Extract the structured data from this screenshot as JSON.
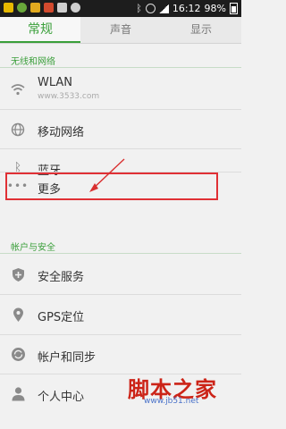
{
  "status_bar": {
    "time": "16:12",
    "battery": "98%",
    "icons": [
      "notification-icon-a",
      "notification-icon-b",
      "notification-icon-c",
      "notification-icon-d",
      "notification-icon-e",
      "notification-icon-f",
      "bluetooth-icon",
      "alarm-icon",
      "signal-icon",
      "battery-icon"
    ],
    "icon_colors": [
      "#e6b800",
      "#68a83a",
      "#e2aa1f",
      "#d24a2e",
      "#cfcfcf",
      "#cfcfcf"
    ]
  },
  "tabs": [
    {
      "label": "常规",
      "active": true
    },
    {
      "label": "声音",
      "active": false
    },
    {
      "label": "显示",
      "active": false
    }
  ],
  "sections": {
    "wireless": "无线和网络",
    "account": "帐户与安全"
  },
  "items": [
    {
      "title": "WLAN",
      "subtitle": "www.3533.com",
      "icon": "wifi-icon"
    },
    {
      "title": "移动网络",
      "icon": "globe-icon"
    },
    {
      "title": "蓝牙",
      "icon": "bluetooth-icon"
    },
    {
      "title": "更多",
      "icon": "more-dots-icon"
    },
    {
      "title": "安全服务",
      "icon": "shield-plus-icon"
    },
    {
      "title": "GPS定位",
      "icon": "location-pin-icon"
    },
    {
      "title": "帐户和同步",
      "icon": "sync-icon"
    },
    {
      "title": "个人中心",
      "icon": "person-icon"
    }
  ],
  "watermark": {
    "text": "脚本之家",
    "url": "www.jb51.net"
  },
  "colors": {
    "accent": "#3a9f3a",
    "highlight": "#e03035",
    "status_bar": "#1d1d1d",
    "background": "#f1f1f1"
  }
}
